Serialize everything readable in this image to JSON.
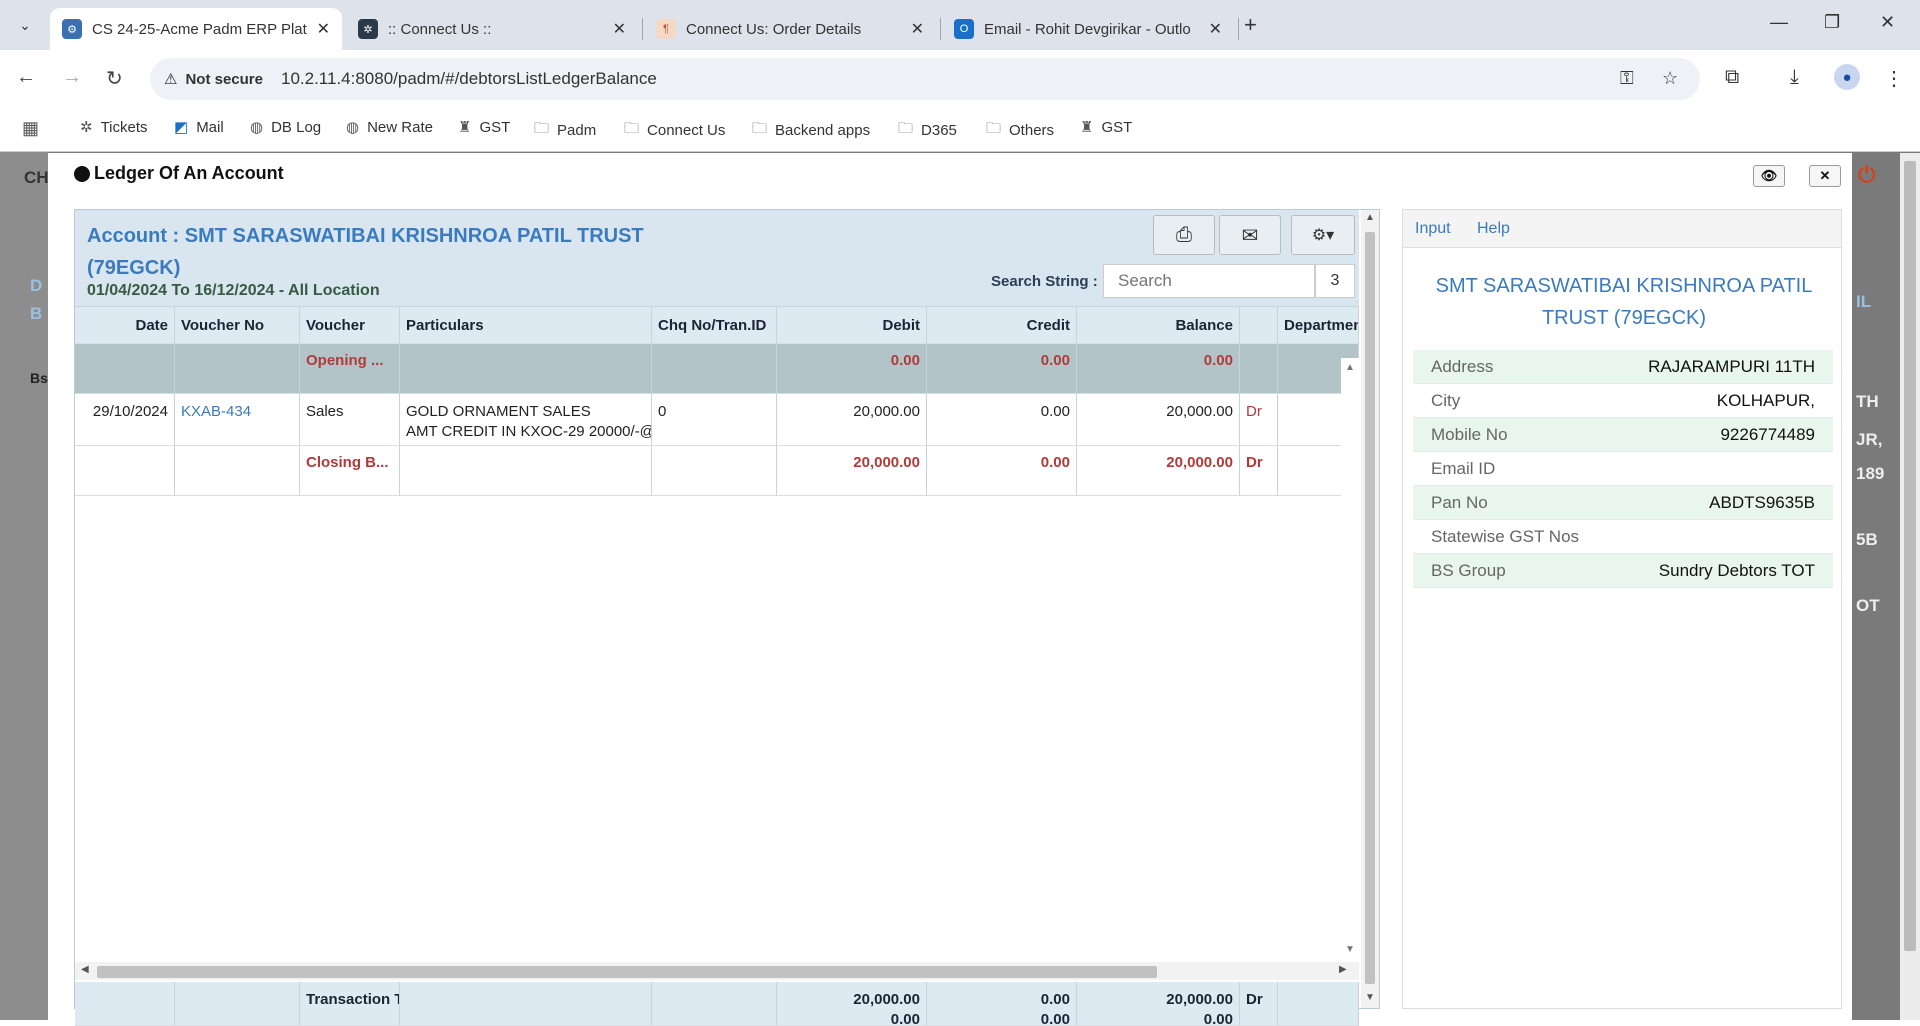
{
  "browser": {
    "tabs": [
      {
        "title": "CS 24-25-Acme Padm ERP Platf",
        "active": true
      },
      {
        "title": ":: Connect Us ::",
        "active": false
      },
      {
        "title": "Connect Us: Order Details",
        "active": false
      },
      {
        "title": "Email - Rohit Devgirikar - Outlo",
        "active": false
      }
    ],
    "new_tab": "+",
    "security_label": "Not secure",
    "url": "10.2.11.4:8080/padm/#/debtorsListLedgerBalance",
    "bookmarks": [
      "Tickets",
      "Mail",
      "DB Log",
      "New Rate",
      "GST",
      "Padm",
      "Connect Us",
      "Backend apps",
      "D365",
      "Others",
      "GST"
    ]
  },
  "background": {
    "partial_text_left": [
      "CH",
      "D",
      "B",
      "Bs"
    ],
    "partial_text_right": [
      "IL",
      "TH",
      "JR,",
      "189",
      "5B",
      "OT"
    ]
  },
  "modal": {
    "title": "Ledger Of An Account",
    "account_line1": "Account : SMT SARASWATIBAI KRISHNROA PATIL TRUST",
    "account_line2": "(79EGCK)",
    "period": "01/04/2024 To 16/12/2024 - All Location",
    "search_label": "Search String :",
    "search_placeholder": "Search",
    "search_count": "3",
    "columns": [
      "Date",
      "Voucher No",
      "Voucher",
      "Particulars",
      "Chq No/Tran.ID",
      "Debit",
      "Credit",
      "Balance",
      "",
      "Departmen"
    ],
    "opening": {
      "voucher": "Opening ...",
      "debit": "0.00",
      "credit": "0.00",
      "balance": "0.00"
    },
    "rows": [
      {
        "date": "29/10/2024",
        "voucher_no": "KXAB-434",
        "voucher": "Sales",
        "particulars1": "GOLD ORNAMENT SALES",
        "particulars2": "AMT CREDIT IN KXOC-29 20000/-@",
        "chq": "0",
        "debit": "20,000.00",
        "credit": "0.00",
        "balance": "20,000.00",
        "drcr": "Dr"
      }
    ],
    "closing": {
      "voucher": "Closing B...",
      "debit": "20,000.00",
      "credit": "0.00",
      "balance": "20,000.00",
      "drcr": "Dr"
    },
    "footer": {
      "label": "Transaction T",
      "debit1": "20,000.00",
      "debit2": "0.00",
      "credit1": "0.00",
      "credit2": "0.00",
      "balance1": "20,000.00",
      "balance2": "0.00",
      "drcr": "Dr"
    }
  },
  "sidepanel": {
    "tabs": [
      "Input",
      "Help"
    ],
    "name": "SMT SARASWATIBAI KRISHNROA PATIL TRUST (79EGCK)",
    "info": [
      {
        "label": "Address",
        "value": "RAJARAMPURI 11TH"
      },
      {
        "label": "City",
        "value": "KOLHAPUR,"
      },
      {
        "label": "Mobile No",
        "value": "9226774489"
      },
      {
        "label": "Email ID",
        "value": ""
      },
      {
        "label": "Pan No",
        "value": "ABDTS9635B"
      },
      {
        "label": "Statewise GST Nos",
        "value": ""
      },
      {
        "label": "BS Group",
        "value": "Sundry Debtors TOT"
      }
    ]
  }
}
